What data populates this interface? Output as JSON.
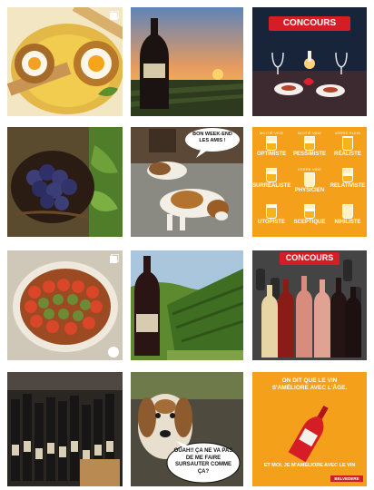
{
  "posts": [
    {
      "id": "egg-soup"
    },
    {
      "id": "wine-sunset"
    },
    {
      "id": "contest-table",
      "badge": "CONCOURS"
    },
    {
      "id": "grapes-basket"
    },
    {
      "id": "dogs-weekend",
      "bubble": "BON WEEK-END LES AMIS !"
    },
    {
      "id": "glass-chart",
      "cells": [
        {
          "cap": "MOITIÉ VIDE",
          "label": "OPTIMISTE",
          "fill": 0.5
        },
        {
          "cap": "MOITIÉ VIDE",
          "label": "PESSIMISTE",
          "fill": 0.5
        },
        {
          "cap": "VERRE PLEIN",
          "label": "RÉALISTE",
          "fill": 0.9
        },
        {
          "cap": "",
          "label": "SURRÉALISTE",
          "fill": 0.6
        },
        {
          "cap": "VERRE VIDE",
          "label": "PHYSICIEN",
          "fill": 0.0
        },
        {
          "cap": "",
          "label": "RELATIVISTE",
          "fill": 0.4
        },
        {
          "cap": "",
          "label": "UTOPISTE",
          "fill": 0.8
        },
        {
          "cap": "",
          "label": "SCEPTIQUE",
          "fill": 0.5
        },
        {
          "cap": "",
          "label": "NIHILISTE",
          "fill": 0.0
        }
      ]
    },
    {
      "id": "tian-dish"
    },
    {
      "id": "wine-vineyard"
    },
    {
      "id": "contest-bottles",
      "badge": "CONCOURS"
    },
    {
      "id": "wine-shelf"
    },
    {
      "id": "dog-speech",
      "bubble": "OUAH!! ÇA NE VA PAS DE ME FAIRE SURSAUTER COMME ÇA?"
    },
    {
      "id": "wine-quote",
      "quote_top": "ON DIT QUE LE VIN S'AMÉLIORE AVEC L'ÂGE.",
      "quote_bottom": "ET MOI, JE M'AMÉLIORE AVEC LE VIN",
      "brand": "BELVEDERE"
    }
  ],
  "colors": {
    "orange": "#f5a01a",
    "red": "#d41d24"
  }
}
